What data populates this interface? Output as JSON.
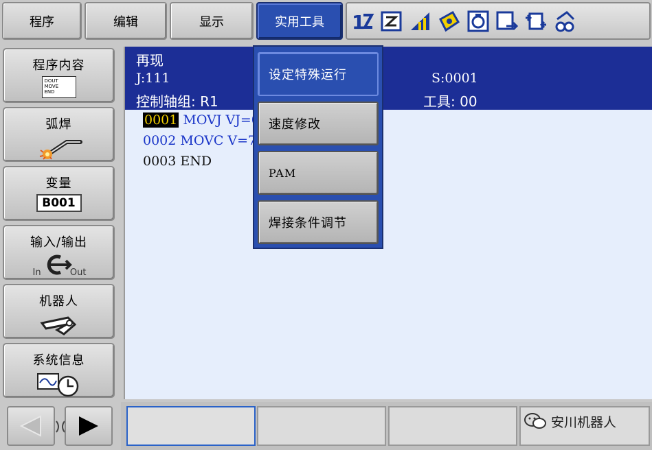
{
  "menu": {
    "tabs": [
      "程序",
      "编辑",
      "显示",
      "实用工具"
    ],
    "active_tab": "实用工具",
    "status_icons": [
      "step-number-icon",
      "edit-lock-icon",
      "signal-icon",
      "play-mode-icon",
      "cycle-icon",
      "io-icon",
      "sync-icon",
      "coordinate-icon"
    ]
  },
  "sidebar": {
    "items": [
      {
        "label": "程序内容",
        "icon": "program-doc-icon",
        "icon_text": [
          "DOUT",
          "MOVE",
          "END"
        ]
      },
      {
        "label": "弧焊",
        "icon": "arc-weld-icon"
      },
      {
        "label": "变量",
        "icon": "variable-icon",
        "icon_text": "B001"
      },
      {
        "label": "输入/输出",
        "icon": "input-output-icon",
        "icon_text_in": "In",
        "icon_text_out": "Out"
      },
      {
        "label": "机器人",
        "icon": "robot-arm-icon"
      },
      {
        "label": "系统信息",
        "icon": "system-info-icon"
      }
    ]
  },
  "program": {
    "mode": "再现",
    "job": "J:111",
    "step": "S:0001",
    "control_group": "控制轴组: R1",
    "tool": "工具: 00",
    "lines": [
      {
        "num": "0001",
        "text": "MOVJ VJ=0"
      },
      {
        "num": "0002",
        "text": "MOVC V=70"
      },
      {
        "num": "0003",
        "text": "END"
      }
    ]
  },
  "dropdown": {
    "items": [
      "设定特殊运行",
      "速度修改",
      "PAM",
      "焊接条件调节"
    ],
    "selected": "设定特殊运行"
  },
  "footer": {
    "watermark": "安川机器人"
  },
  "colors": {
    "header_blue": "#1c2e96",
    "menu_active": "#2a4fb0",
    "program_text": "#1a35c8",
    "line_highlight": "#f2d000"
  }
}
